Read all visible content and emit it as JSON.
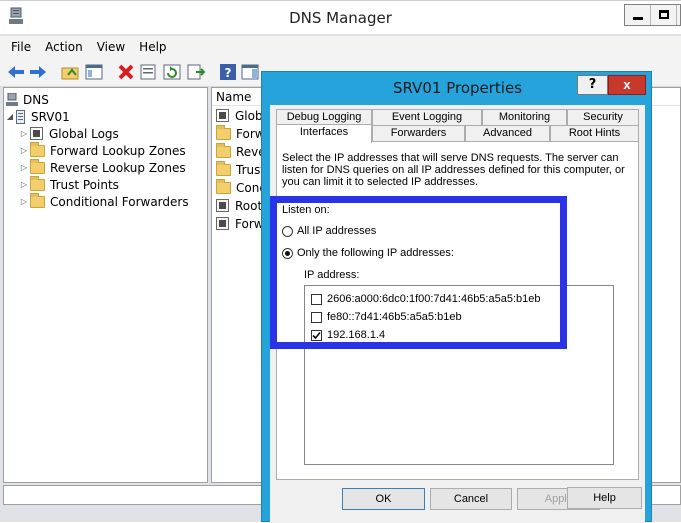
{
  "window": {
    "title": "DNS Manager"
  },
  "menu": [
    "File",
    "Action",
    "View",
    "Help"
  ],
  "toolbar": {
    "icons": [
      "back-arrow-icon",
      "forward-arrow-icon",
      "folder-up-icon",
      "show-hide-console-icon",
      "delete-icon",
      "properties-icon",
      "refresh-icon",
      "export-list-icon",
      "help-icon",
      "show-pane-icon"
    ]
  },
  "tree": {
    "root": "DNS",
    "server": "SRV01",
    "items": [
      "Global Logs",
      "Forward Lookup Zones",
      "Reverse Lookup Zones",
      "Trust Points",
      "Conditional Forwarders"
    ]
  },
  "list": {
    "header_name": "Name",
    "items": [
      "Global",
      "Forwa",
      "Revers",
      "Trust P",
      "Condi",
      "Root H",
      "Forwa"
    ]
  },
  "dialog": {
    "title": "SRV01 Properties",
    "help_label": "?",
    "close_label": "x",
    "tabs_row1": [
      "Debug Logging",
      "Event Logging",
      "Monitoring",
      "Security"
    ],
    "tabs_row2": [
      "Interfaces",
      "Forwarders",
      "Advanced",
      "Root Hints"
    ],
    "description": "Select the IP addresses that will serve DNS requests. The server can listen for DNS queries on all IP addresses defined for this computer, or you can limit it to selected IP addresses.",
    "listen_on": "Listen on:",
    "radio_all": "All IP addresses",
    "radio_only": "Only the following IP addresses:",
    "ip_address_label": "IP address:",
    "ip_addresses": [
      {
        "address": "2606:a000:6dc0:1f00:7d41:46b5:a5a5:b1eb",
        "checked": false
      },
      {
        "address": "fe80::7d41:46b5:a5a5:b1eb",
        "checked": false
      },
      {
        "address": "192.168.1.4",
        "checked": true
      }
    ],
    "buttons": {
      "ok": "OK",
      "cancel": "Cancel",
      "apply": "Apply",
      "help": "Help"
    }
  },
  "colors": {
    "dialog_frame": "#27a3dc",
    "highlight": "#2b33e8",
    "close_button": "#c7392d"
  }
}
